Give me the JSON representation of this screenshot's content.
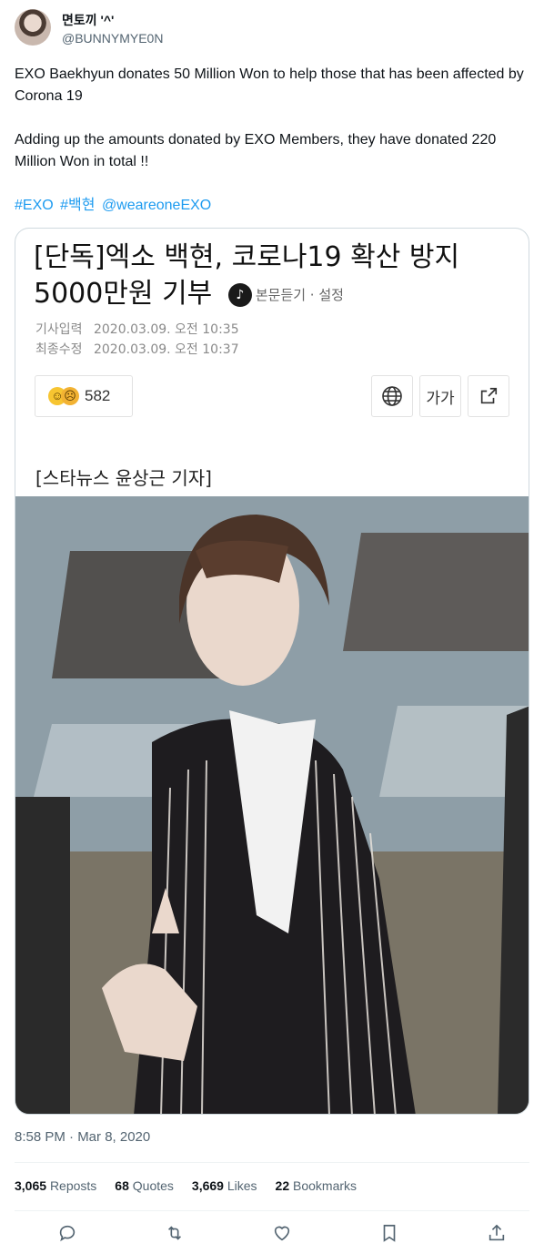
{
  "author": {
    "name": "면토끼 '^'",
    "handle": "@BUNNYMYE0N"
  },
  "tweet": {
    "paragraphs": [
      "EXO Baekhyun donates 50 Million Won to help those that has been affected by Corona 19",
      "Adding up the amounts donated by EXO Members, they have donated 220 Million Won in total !!"
    ],
    "hashtags": [
      "#EXO",
      "#백현",
      "@weareoneEXO"
    ]
  },
  "article": {
    "headline": "[단독]엑소 백현, 코로나19 확산 방지 5000만원 기부",
    "listen_label": "본문듣기 · 설정",
    "published_label": "기사입력",
    "published": "2020.03.09. 오전 10:35",
    "modified_label": "최종수정",
    "modified": "2020.03.09. 오전 10:37",
    "reaction_count": "582",
    "font_size_label": "가가",
    "byline": "[스타뉴스 윤상근 기자]"
  },
  "timestamp": "8:58 PM · Mar 8, 2020",
  "stats": [
    {
      "count": "3,065",
      "label": "Reposts"
    },
    {
      "count": "68",
      "label": "Quotes"
    },
    {
      "count": "3,669",
      "label": "Likes"
    },
    {
      "count": "22",
      "label": "Bookmarks"
    }
  ],
  "actions": [
    "reply-icon",
    "repost-icon",
    "like-icon",
    "bookmark-icon",
    "share-icon"
  ]
}
